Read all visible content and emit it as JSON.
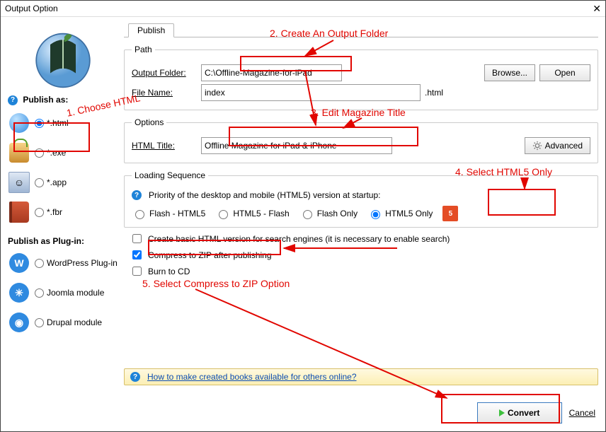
{
  "window": {
    "title": "Output Option"
  },
  "tabs": [
    {
      "label": "Publish"
    }
  ],
  "sidebar": {
    "publish_as_label": "Publish as:",
    "formats": [
      {
        "label": "*.html",
        "checked": true
      },
      {
        "label": "*.exe",
        "checked": false
      },
      {
        "label": "*.app",
        "checked": false
      },
      {
        "label": "*.fbr",
        "checked": false
      }
    ],
    "plugin_header": "Publish as Plug-in:",
    "plugins": [
      {
        "label": "WordPress Plug-in"
      },
      {
        "label": "Joomla module"
      },
      {
        "label": "Drupal module"
      }
    ]
  },
  "path": {
    "legend": "Path",
    "output_folder_label": "Output Folder:",
    "output_folder_value": "C:\\Offline-Magazine-for-iPad",
    "file_name_label": "File Name:",
    "file_name_value": "index",
    "file_ext": ".html",
    "browse": "Browse...",
    "open": "Open"
  },
  "options": {
    "legend": "Options",
    "html_title_label": "HTML Title:",
    "html_title_value": "Offline Magazine for iPad & iPhone",
    "advanced": "Advanced"
  },
  "loading": {
    "legend": "Loading Sequence",
    "priority_text": "Priority of the desktop and mobile (HTML5) version at startup:",
    "opts": [
      "Flash - HTML5",
      "HTML5 - Flash",
      "Flash Only",
      "HTML5 Only"
    ],
    "selected": 3
  },
  "checks": {
    "basic_html": {
      "label": "Create basic HTML version for search engines (it is necessary to enable search)",
      "checked": false
    },
    "zip": {
      "label": "Compress to ZIP after publishing",
      "checked": true
    },
    "burn": {
      "label": "Burn to CD",
      "checked": false
    }
  },
  "link": {
    "text": "How to make created books available for others online?"
  },
  "footer": {
    "convert": "Convert",
    "cancel": "Cancel"
  },
  "annotations": {
    "a1": "1. Choose HTML",
    "a2": "2. Create An Output Folder",
    "a3": "3. Edit Magazine Title",
    "a4": "4. Select HTML5 Only",
    "a5": "5. Select Compress to ZIP Option"
  }
}
